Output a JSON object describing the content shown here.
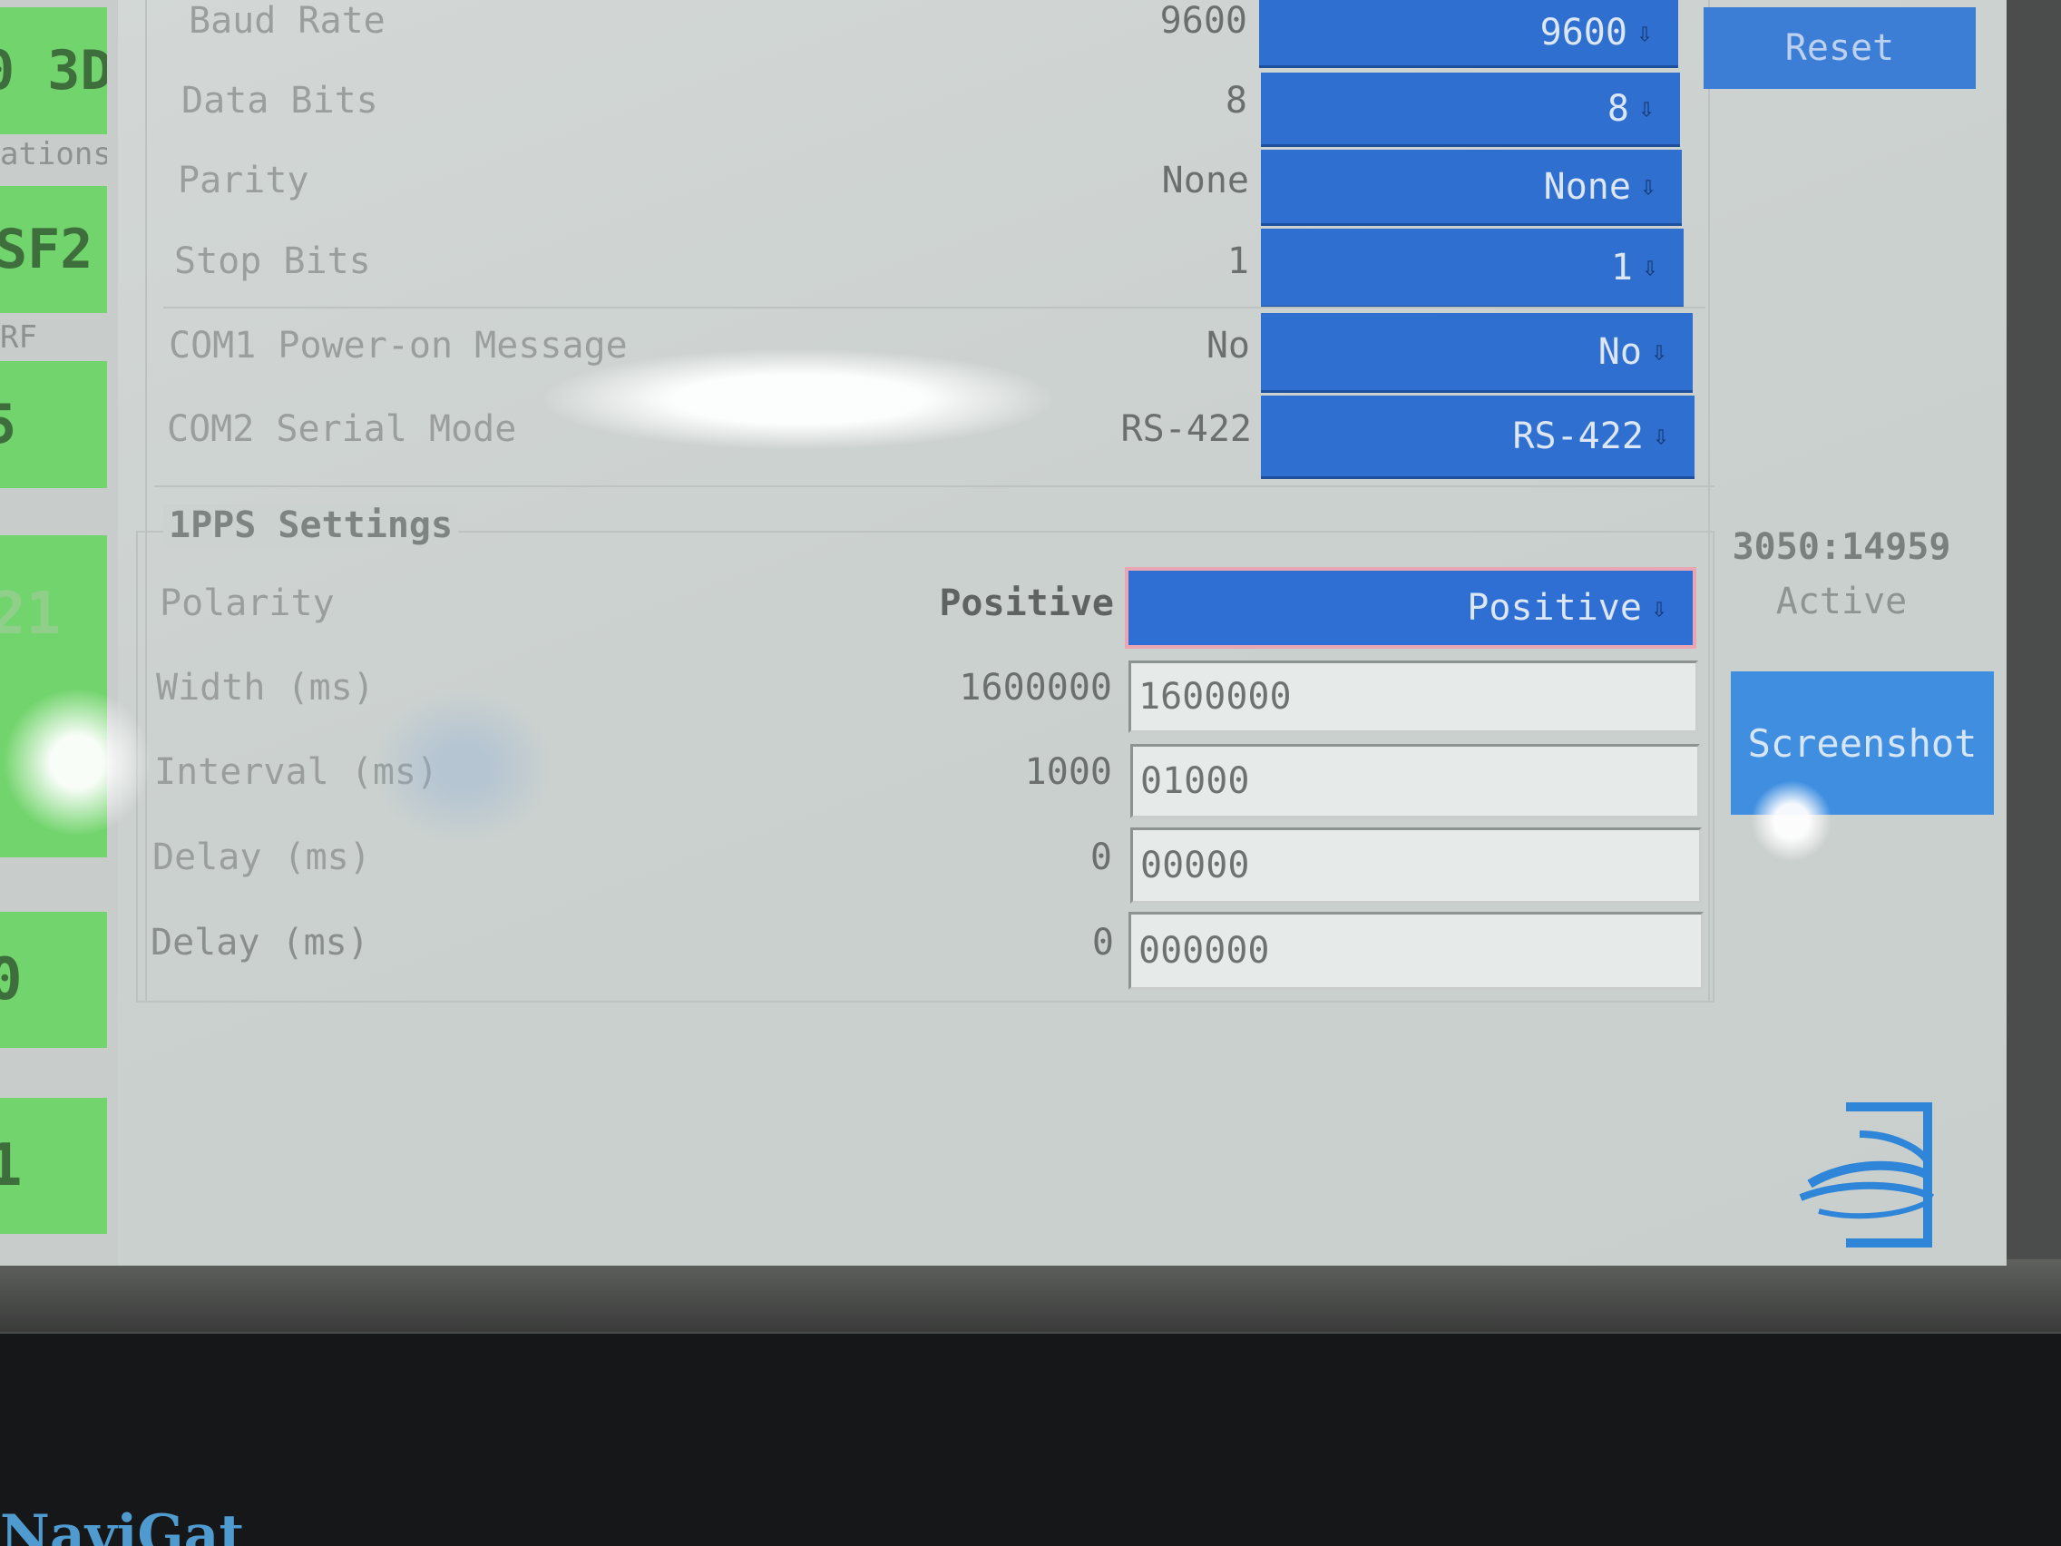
{
  "left_status": {
    "tiles": [
      {
        "text": "0 3D"
      },
      {
        "caption": "ations"
      },
      {
        "text": "SF2"
      },
      {
        "caption": "RF"
      },
      {
        "text": "5"
      },
      {
        "text": "21"
      },
      {
        "text": "0"
      },
      {
        "text": "1"
      }
    ]
  },
  "serial": {
    "rows": [
      {
        "label": "Baud Rate",
        "value": "9600",
        "selected": "9600"
      },
      {
        "label": "Data Bits",
        "value": "8",
        "selected": "8"
      },
      {
        "label": "Parity",
        "value": "None",
        "selected": "None"
      },
      {
        "label": "Stop Bits",
        "value": "1",
        "selected": "1"
      },
      {
        "label": "COM1 Power-on Message",
        "value": "No",
        "selected": "No"
      },
      {
        "label": "COM2 Serial Mode",
        "value": "RS-422",
        "selected": "RS-422"
      }
    ]
  },
  "pps": {
    "title": "1PPS Settings",
    "polarity": {
      "label": "Polarity",
      "value": "Positive",
      "selected": "Positive"
    },
    "fields": [
      {
        "label": "Width (ms)",
        "value": "1600000",
        "input": "1600000"
      },
      {
        "label": "Interval (ms)",
        "value": "1000",
        "input": "01000"
      },
      {
        "label": "Delay (ms)",
        "value": "0",
        "input": "00000"
      },
      {
        "label": "Delay (ms)",
        "value": "0",
        "input": "000000"
      }
    ]
  },
  "sidebar": {
    "reset_label": "Reset",
    "gps_time": "3050:14959",
    "status": "Active",
    "screenshot_label": "Screenshot"
  },
  "brand_text": "NaviGat",
  "icons": {
    "dropdown_arrow": "down-arrow-icon",
    "logo": "swirl-logo-icon"
  },
  "colors": {
    "dropdown_bg": "#2e6fd0",
    "status_tile": "#72d46c",
    "screen_bg": "#cdd3d1"
  }
}
